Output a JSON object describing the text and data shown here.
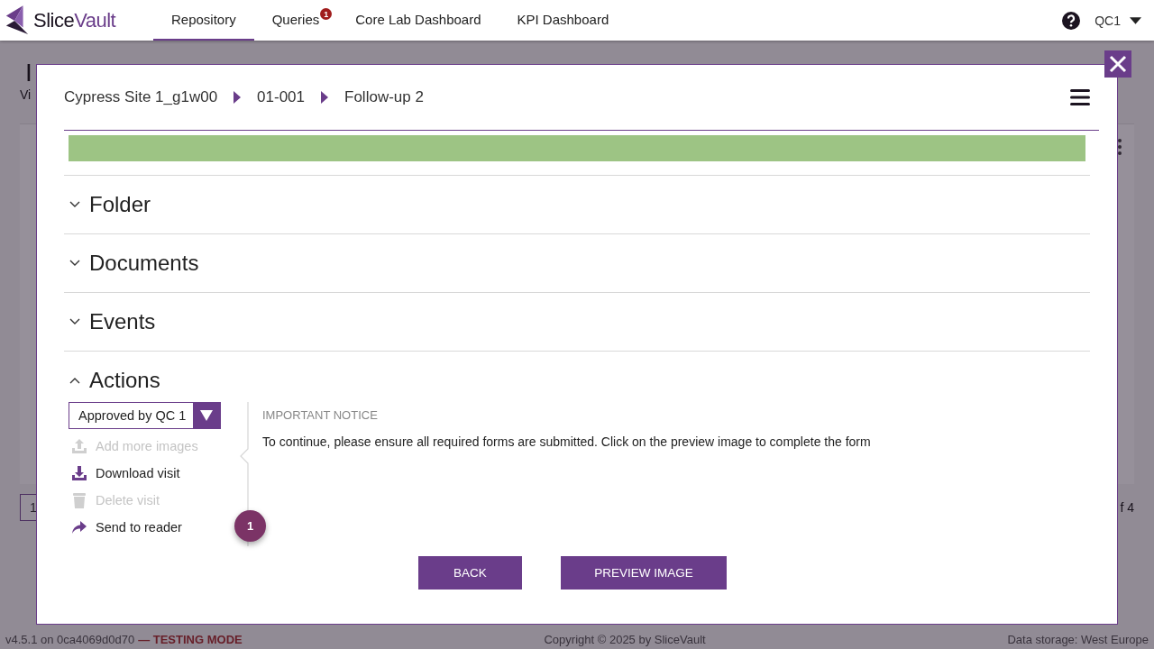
{
  "header": {
    "logo": {
      "part_1": "Slice",
      "part_2": "Vault"
    },
    "tabs": [
      {
        "label": "Repository",
        "selected": true
      },
      {
        "label": "Queries",
        "selected": false,
        "badge": "1"
      },
      {
        "label": "Core Lab Dashboard",
        "selected": false
      },
      {
        "label": "KPI Dashboard",
        "selected": false
      }
    ],
    "user": "QC1"
  },
  "background_page": {
    "title": "I",
    "subtitle": "Vi",
    "pagination_page": "1",
    "pagination_total": "f 4"
  },
  "footer": {
    "version": "v4.5.1 on 0ca4069d0d70",
    "mode": "— TESTING MODE",
    "copyright": "Copyright © 2025 by SliceVault",
    "storage": "Data storage: West Europe"
  },
  "modal": {
    "breadcrumb": [
      "Cypress Site 1_g1w00",
      "01-001",
      "Follow-up 2"
    ],
    "sections": [
      {
        "title": "Folder",
        "expanded": false
      },
      {
        "title": "Documents",
        "expanded": false
      },
      {
        "title": "Events",
        "expanded": false
      },
      {
        "title": "Actions",
        "expanded": true
      }
    ],
    "actions": {
      "status_select": "Approved by QC 1",
      "items": [
        {
          "label": "Add more images",
          "kind": "upload",
          "disabled": true
        },
        {
          "label": "Download visit",
          "kind": "download",
          "disabled": false
        },
        {
          "label": "Delete visit",
          "kind": "delete",
          "disabled": true
        },
        {
          "label": "Send to reader",
          "kind": "send",
          "disabled": false
        }
      ],
      "notice_title": "IMPORTANT NOTICE",
      "notice_text": "To continue, please ensure all required forms are submitted. Click on the preview image to complete the form",
      "step_badge": "1"
    },
    "buttons": [
      "BACK",
      "PREVIEW IMAGE"
    ]
  }
}
